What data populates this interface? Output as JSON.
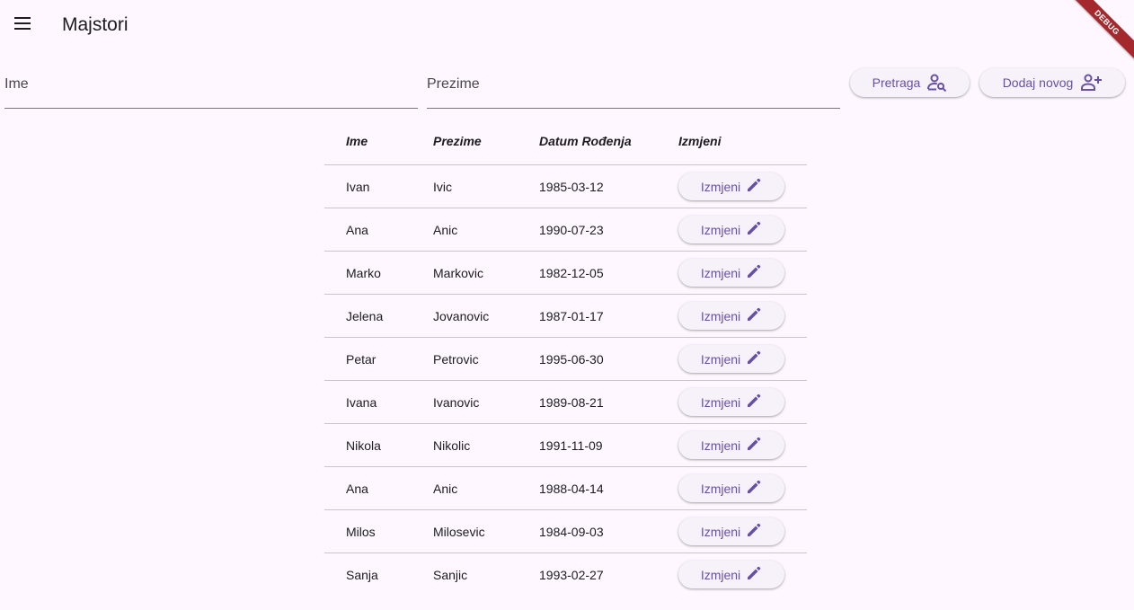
{
  "appbar": {
    "title": "Majstori",
    "debug_label": "DEBUG"
  },
  "search": {
    "first_name_placeholder": "Ime",
    "last_name_placeholder": "Prezime",
    "search_button_label": "Pretraga",
    "add_button_label": "Dodaj novog"
  },
  "icons": {
    "menu": "menu-icon",
    "search": "person-search-icon",
    "add": "person-add-icon",
    "edit": "pencil-icon"
  },
  "colors": {
    "background": "#fef7ff",
    "accent": "#6750a4",
    "button_bg": "#f7f2fa",
    "divider": "#cac4d0",
    "debug_banner": "#a4282c"
  },
  "table": {
    "headers": [
      "Ime",
      "Prezime",
      "Datum Rođenja",
      "Izmjeni"
    ],
    "edit_label": "Izmjeni",
    "rows": [
      {
        "first_name": "Ivan",
        "last_name": "Ivic",
        "birth_date": "1985-03-12"
      },
      {
        "first_name": "Ana",
        "last_name": "Anic",
        "birth_date": "1990-07-23"
      },
      {
        "first_name": "Marko",
        "last_name": "Markovic",
        "birth_date": "1982-12-05"
      },
      {
        "first_name": "Jelena",
        "last_name": "Jovanovic",
        "birth_date": "1987-01-17"
      },
      {
        "first_name": "Petar",
        "last_name": "Petrovic",
        "birth_date": "1995-06-30"
      },
      {
        "first_name": "Ivana",
        "last_name": "Ivanovic",
        "birth_date": "1989-08-21"
      },
      {
        "first_name": "Nikola",
        "last_name": "Nikolic",
        "birth_date": "1991-11-09"
      },
      {
        "first_name": "Ana",
        "last_name": "Anic",
        "birth_date": "1988-04-14"
      },
      {
        "first_name": "Milos",
        "last_name": "Milosevic",
        "birth_date": "1984-09-03"
      },
      {
        "first_name": "Sanja",
        "last_name": "Sanjic",
        "birth_date": "1993-02-27"
      }
    ]
  }
}
